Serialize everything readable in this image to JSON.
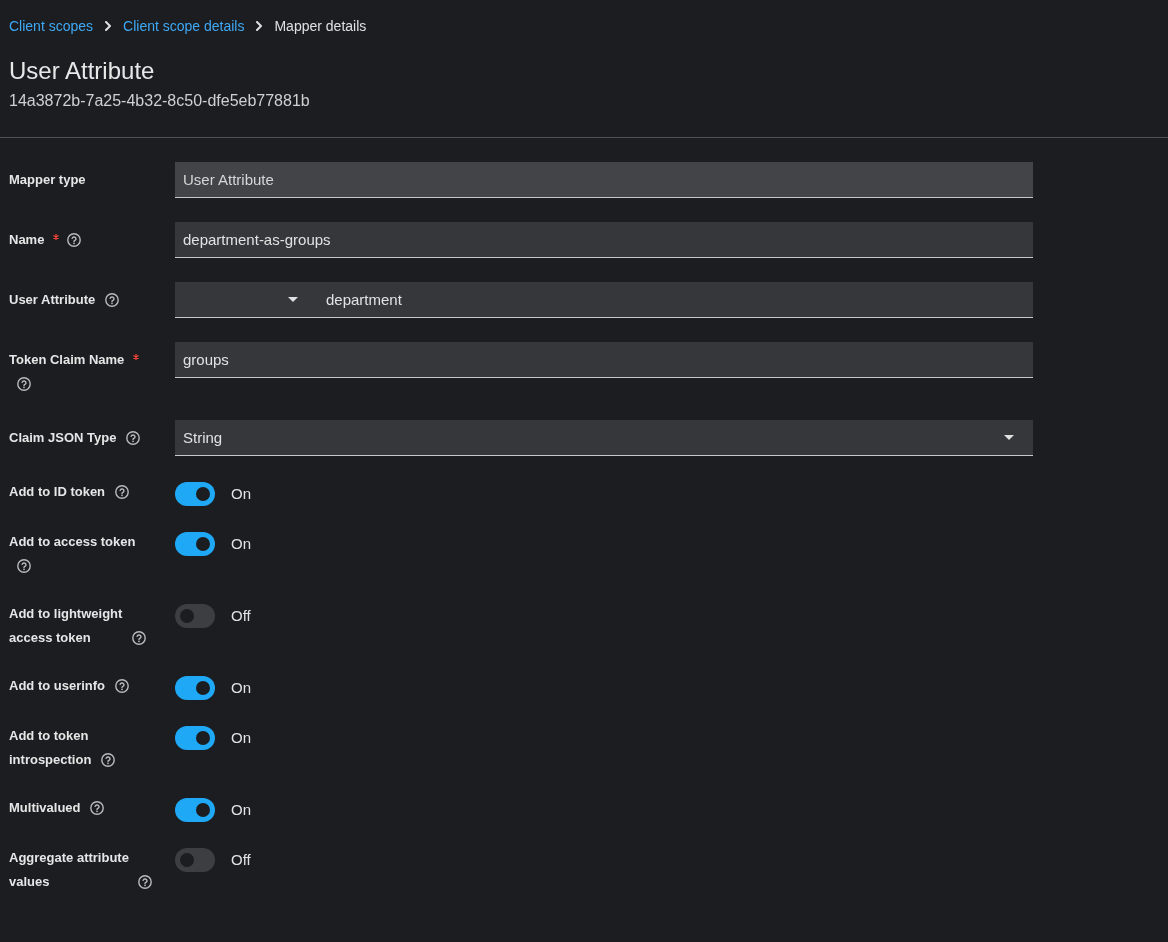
{
  "breadcrumb": [
    {
      "label": "Client scopes",
      "current": false
    },
    {
      "label": "Client scope details",
      "current": false
    },
    {
      "label": "Mapper details",
      "current": true
    }
  ],
  "header": {
    "title": "User Attribute",
    "id": "14a3872b-7a25-4b32-8c50-dfe5eb77881b"
  },
  "fields": [
    {
      "kind": "text",
      "label": "Mapper type",
      "required": false,
      "help": false,
      "read_only": true,
      "value": "User Attribute"
    },
    {
      "kind": "text",
      "label": "Name",
      "required": true,
      "help": true,
      "read_only": false,
      "value": "department-as-groups"
    },
    {
      "kind": "typeahead",
      "label": "User Attribute",
      "required": false,
      "help": true,
      "read_only": false,
      "value": "department"
    },
    {
      "kind": "text",
      "label": "Token Claim Name",
      "required": true,
      "help": true,
      "read_only": false,
      "value": "groups"
    },
    {
      "kind": "select",
      "label": "Claim JSON Type",
      "required": false,
      "help": true,
      "read_only": false,
      "value": "String"
    }
  ],
  "switches": [
    {
      "label": "Add to ID token",
      "on": true,
      "state_label": "On"
    },
    {
      "label": "Add to access token",
      "on": true,
      "state_label": "On"
    },
    {
      "label": "Add to lightweight access token",
      "on": false,
      "state_label": "Off"
    },
    {
      "label": "Add to userinfo",
      "on": true,
      "state_label": "On"
    },
    {
      "label": "Add to token introspection",
      "on": true,
      "state_label": "On"
    },
    {
      "label": "Multivalued",
      "on": true,
      "state_label": "On"
    },
    {
      "label": "Aggregate attribute values",
      "on": false,
      "state_label": "Off"
    }
  ]
}
